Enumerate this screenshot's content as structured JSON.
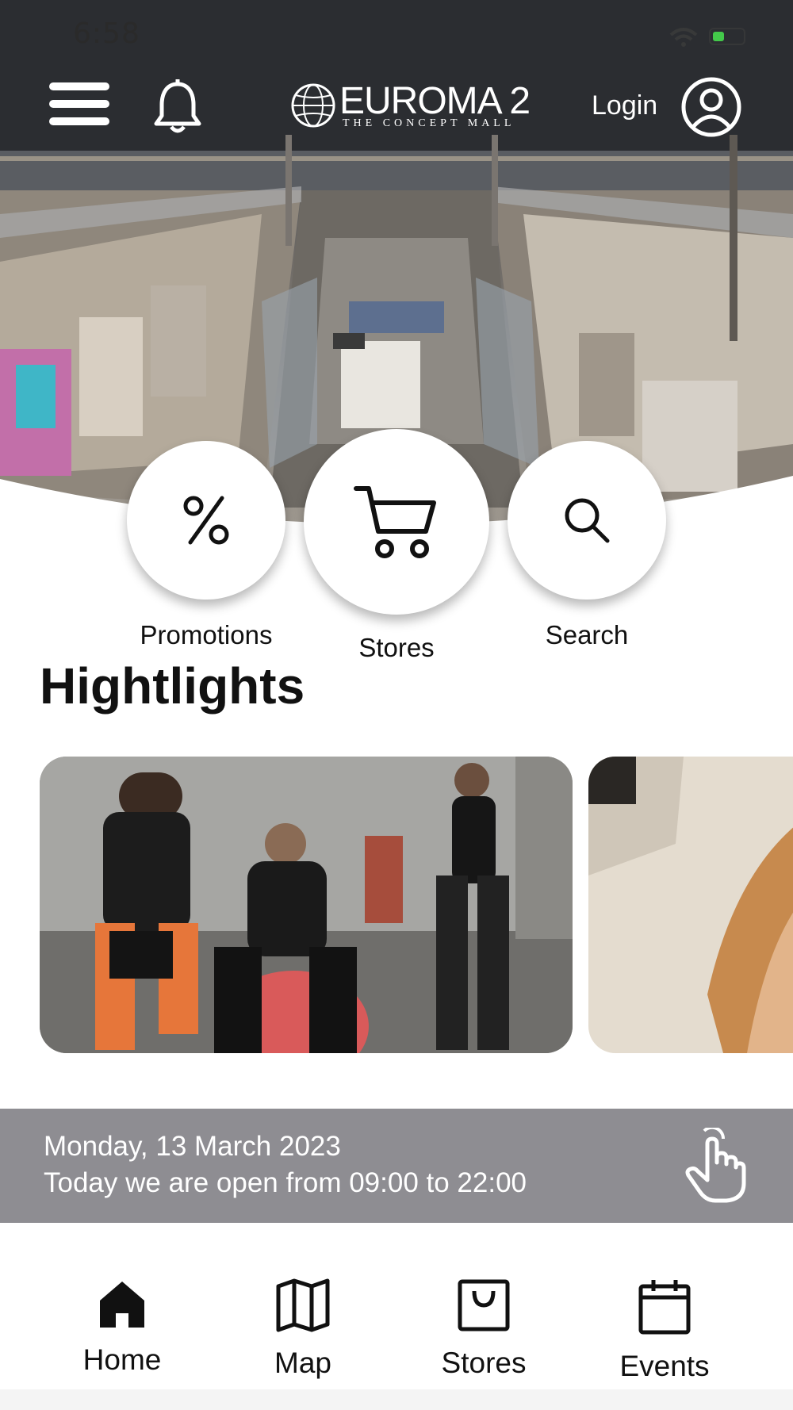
{
  "status_bar": {
    "time": "6:58",
    "battery_color": "#43c84a"
  },
  "header": {
    "logo_name": "EUROMA 2",
    "logo_tagline": "THE CONCEPT MALL",
    "login_label": "Login",
    "menu_icon": "hamburger-menu-icon",
    "notifications_icon": "bell-icon",
    "account_icon": "user-circle-icon"
  },
  "quick_actions": [
    {
      "label": "Promotions",
      "icon": "percent-icon"
    },
    {
      "label": "Stores",
      "icon": "shopping-cart-icon"
    },
    {
      "label": "Search",
      "icon": "search-icon"
    }
  ],
  "highlights": {
    "title": "Hightlights",
    "cards": [
      {
        "image": "fitness-people-photo"
      },
      {
        "image": "woman-portrait-photo"
      }
    ]
  },
  "opening_info": {
    "date": "Monday, 13 March 2023",
    "hours": "Today we are open from 09:00 to 22:00",
    "icon": "tap-hand-icon",
    "background": "#8e8d92"
  },
  "bottom_nav": [
    {
      "label": "Home",
      "icon": "home-icon",
      "active": true
    },
    {
      "label": "Map",
      "icon": "map-icon",
      "active": false
    },
    {
      "label": "Stores",
      "icon": "shopping-bag-icon",
      "active": false
    },
    {
      "label": "Events",
      "icon": "calendar-icon",
      "active": false
    }
  ]
}
